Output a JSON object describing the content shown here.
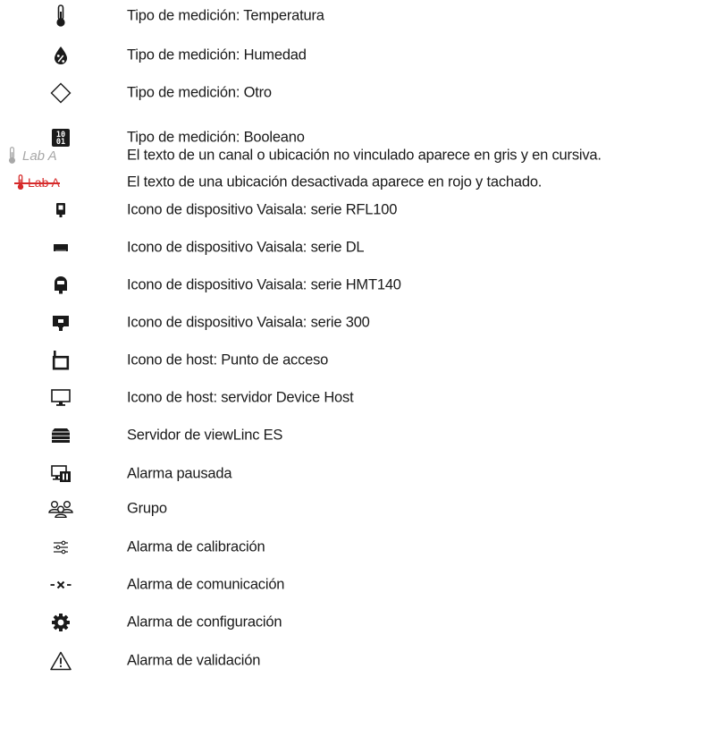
{
  "legend": {
    "rows": [
      {
        "icon": "thermometer-icon",
        "text": "Tipo de medición: Temperatura"
      },
      {
        "icon": "humidity-drop-icon",
        "text": "Tipo de medición: Humedad"
      },
      {
        "icon": "diamond-outline-icon",
        "text": "Tipo de medición: Otro"
      },
      {
        "icon": "boolean-binary-icon",
        "text": "Tipo de medición: Booleano",
        "glyph_top": "10",
        "glyph_bottom": "01"
      },
      {
        "icon": "thermometer-gray-icon",
        "label": "Lab A",
        "text": "El texto de un canal o ubicación no vinculado aparece en gris y en cursiva."
      },
      {
        "icon": "thermometer-red-icon",
        "label": "Lab A",
        "text": "El texto de una ubicación desactivada aparece en rojo y tachado."
      },
      {
        "icon": "device-rfl100-icon",
        "text": "Icono de dispositivo Vaisala: serie RFL100"
      },
      {
        "icon": "device-dl-icon",
        "text": "Icono de dispositivo Vaisala: serie DL"
      },
      {
        "icon": "device-hmt140-icon",
        "text": "Icono de dispositivo Vaisala: serie HMT140"
      },
      {
        "icon": "device-300-icon",
        "text": "Icono de dispositivo Vaisala: serie 300"
      },
      {
        "icon": "access-point-icon",
        "text": "Icono de host: Punto de acceso"
      },
      {
        "icon": "monitor-icon",
        "text": "Icono de host: servidor Device Host"
      },
      {
        "icon": "server-stack-icon",
        "text": "Servidor de viewLinc ES"
      },
      {
        "icon": "alarm-paused-icon",
        "text": "Alarma pausada"
      },
      {
        "icon": "group-icon",
        "text": "Grupo"
      },
      {
        "icon": "sliders-icon",
        "text": "Alarma de calibración"
      },
      {
        "icon": "comm-x-icon",
        "text": "Alarma de comunicación"
      },
      {
        "icon": "gear-icon",
        "text": "Alarma de configuración"
      },
      {
        "icon": "warning-triangle-icon",
        "text": "Alarma de validación"
      }
    ]
  },
  "colors": {
    "text": "#1a1a1a",
    "icon": "#1a1a1a",
    "unlinked_gray": "#a8a8a8",
    "deactivated_red": "#d62a2a"
  }
}
